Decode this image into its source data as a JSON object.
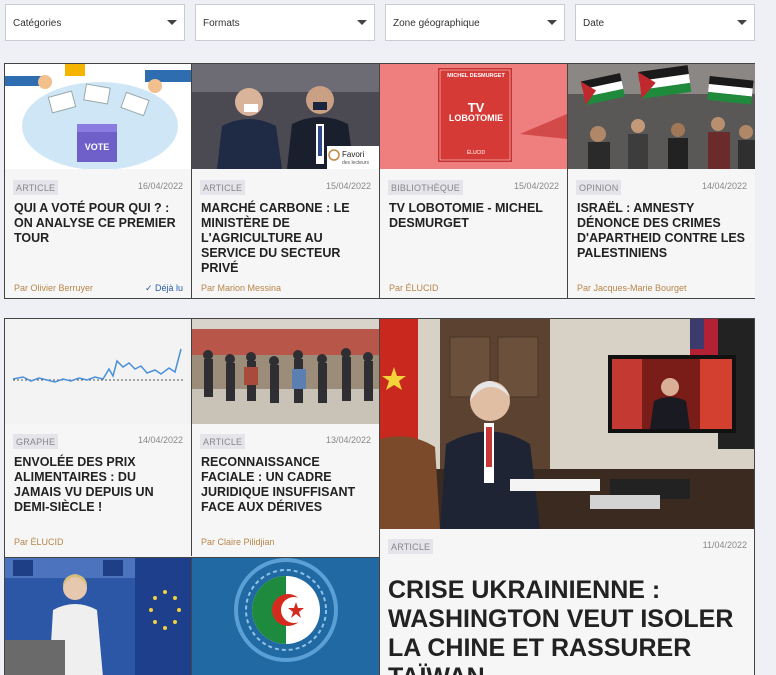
{
  "filters": [
    {
      "label": "Catégories"
    },
    {
      "label": "Formats"
    },
    {
      "label": "Zone géographique"
    },
    {
      "label": "Date"
    }
  ],
  "row1": [
    {
      "category": "ARTICLE",
      "date": "16/04/2022",
      "title": "QUI A VOTÉ POUR QUI ? : ON ANALYSE CE PREMIER TOUR",
      "author": "Par Olivier Berruyer",
      "seen": "✓ Déjà lu"
    },
    {
      "category": "ARTICLE",
      "date": "15/04/2022",
      "title": "MARCHÉ CARBONE : LE MINISTÈRE DE L'AGRICULTURE AU SERVICE DU SECTEUR PRIVÉ",
      "author": "Par Marion Messina",
      "badge": "Favori",
      "badge_sub": "des lecteurs"
    },
    {
      "category": "BIBLIOTHÈQUE",
      "date": "15/04/2022",
      "title": "TV LOBOTOMIE - MICHEL DESMURGET",
      "author": "Par ÉLUCID",
      "book_author": "MICHEL DESMURGET",
      "book_title_1": "TV",
      "book_title_2": "LOBOTOMIE",
      "book_pub": "ÉLUCID"
    },
    {
      "category": "OPINION",
      "date": "14/04/2022",
      "title": "ISRAËL : AMNESTY DÉNONCE DES CRIMES D'APARTHEID CONTRE LES PALESTINIENS",
      "author": "Par Jacques-Marie Bourget"
    }
  ],
  "row2": [
    {
      "category": "GRAPHE",
      "date": "14/04/2022",
      "title": "ENVOLÉE DES PRIX ALIMENTAIRES : DU JAMAIS VU DEPUIS UN DEMI-SIÈCLE !",
      "author": "Par ÉLUCID"
    },
    {
      "category": "ARTICLE",
      "date": "13/04/2022",
      "title": "RECONNAISSANCE FACIALE : UN CADRE JURIDIQUE INSUFFISANT FACE AUX DÉRIVES",
      "author": "Par Claire Pilidjian"
    }
  ],
  "feature": {
    "category": "ARTICLE",
    "date": "11/04/2022",
    "title": "CRISE UKRAINIENNE : WASHINGTON VEUT ISOLER LA CHINE ET RASSURER TAÏWAN"
  },
  "colors": {
    "author": "#b7864a",
    "seen": "#2b5aa8",
    "border": "#444444",
    "background": "#eef0f6"
  }
}
